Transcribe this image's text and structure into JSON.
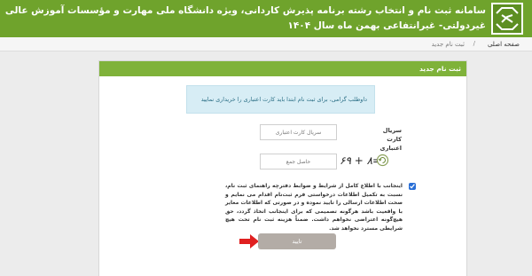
{
  "header": {
    "title": "سامانه ثبت نام و انتخاب رشته برنامه پذیرش کاردانی، ویژه دانشگاه ملی مهارت و مؤسسات آموزش عالی غیردولتی- غیرانتفاعی بهمن ماه سال ۱۴۰۴",
    "logo_icon": "university-logo-icon"
  },
  "breadcrumb": {
    "home": "صفحه اصلی",
    "separator": "/",
    "current": "ثبت نام جدید"
  },
  "panel": {
    "title": "ثبت نام جدید"
  },
  "notice": {
    "text": "داوطلب گرامی، برای ثبت نام ابتدا باید کارت اعتباری را خریداری نمایید"
  },
  "form": {
    "serial_label": "سریال کارت اعتباری",
    "serial_placeholder": "سریال کارت اعتباری",
    "sum_placeholder": "حاصل جمع",
    "captcha_text": "=۸ + ۶۹",
    "agree_checked": true,
    "agree_text": "اینجانب با اطلاع کامل از شرایط و ضوابط دفترچه راهنمای ثبت نام، نسبت به تکمیل اطلاعات درخواستی فرم ثبت‌نام اقدام می نمایم و صحت اطلاعات ارسالی را تایید نموده و در صورتی که اطلاعات مغایر با واقعیت باشد هرگونه تصمیمی که برای اینجانب اتخاذ گردد، حق هیچ‌گونه اعتراضی نخواهم داشت. ضمناً هزینه ثبت نام تحت هیچ شرایطی مسترد نخواهد شد.",
    "submit_label": "تایید"
  },
  "colors": {
    "header_green": "#6fa32c",
    "panel_header_green": "#7fb23a",
    "notice_bg": "#d7edf5",
    "button_gray": "#b3aca6",
    "arrow_red": "#e02020"
  }
}
